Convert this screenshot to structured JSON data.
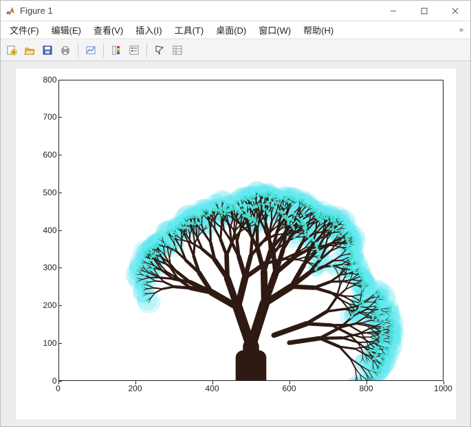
{
  "window": {
    "title": "Figure 1"
  },
  "menu": {
    "file": "文件(F)",
    "edit": "编辑(E)",
    "view": "查看(V)",
    "insert": "插入(I)",
    "tools": "工具(T)",
    "desktop": "桌面(D)",
    "window": "窗口(W)",
    "help": "帮助(H)"
  },
  "toolbar": {
    "new": "new-figure",
    "open": "open",
    "save": "save",
    "print": "print",
    "link": "link-data",
    "colorbar": "insert-colorbar",
    "legend": "insert-legend",
    "cursor": "edit-plot",
    "props": "property-inspector"
  },
  "chart_data": {
    "type": "other",
    "title": "",
    "xlabel": "",
    "ylabel": "",
    "xlim": [
      0,
      1000
    ],
    "ylim": [
      0,
      800
    ],
    "xticks": [
      0,
      200,
      400,
      600,
      800,
      1000
    ],
    "yticks": [
      0,
      100,
      200,
      300,
      400,
      500,
      600,
      700,
      800
    ],
    "description": "Recursive fractal tree rooted near x≈500, y=0; brown branches fanning upward and rightward with cyan glowing tips; canopy spans roughly x∈[120,990], y∈[60,450]."
  }
}
